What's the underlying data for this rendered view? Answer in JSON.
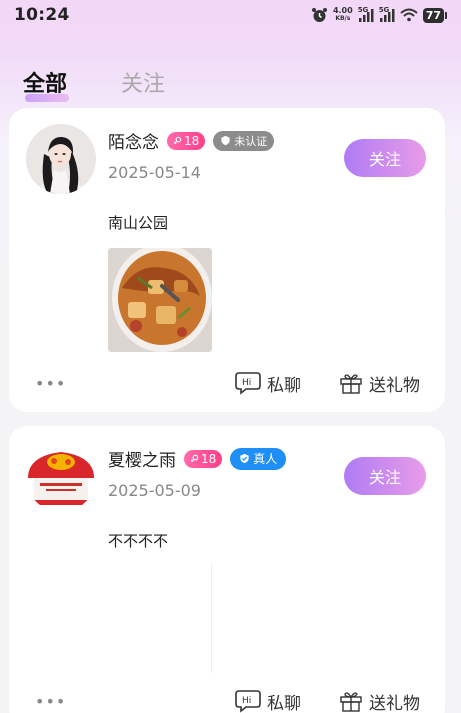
{
  "status_bar": {
    "time": "10:24",
    "net_speed_value": "4.00",
    "net_speed_unit": "KB/s",
    "signal_1": "5G",
    "signal_2": "5G",
    "battery": "77"
  },
  "tabs": [
    {
      "label": "全部",
      "active": true
    },
    {
      "label": "关注",
      "active": false
    }
  ],
  "posts": [
    {
      "name": "陌念念",
      "age": "18",
      "badge": "未认证",
      "date": "2025-05-14",
      "follow_label": "关注",
      "text": "南山公园",
      "more": "•••",
      "chat_label": "私聊",
      "gift_label": "送礼物"
    },
    {
      "name": "夏樱之雨",
      "age": "18",
      "badge": "真人",
      "date": "2025-05-09",
      "follow_label": "关注",
      "text": "不不不不",
      "more": "•••",
      "chat_label": "私聊",
      "gift_label": "送礼物"
    }
  ],
  "colors": {
    "accent_gradient_start": "#b07cf4",
    "accent_gradient_end": "#e79ce8",
    "age_badge": "#ff4f92",
    "real_badge": "#1f8ef5",
    "unverified_badge": "#8c8c8c"
  }
}
